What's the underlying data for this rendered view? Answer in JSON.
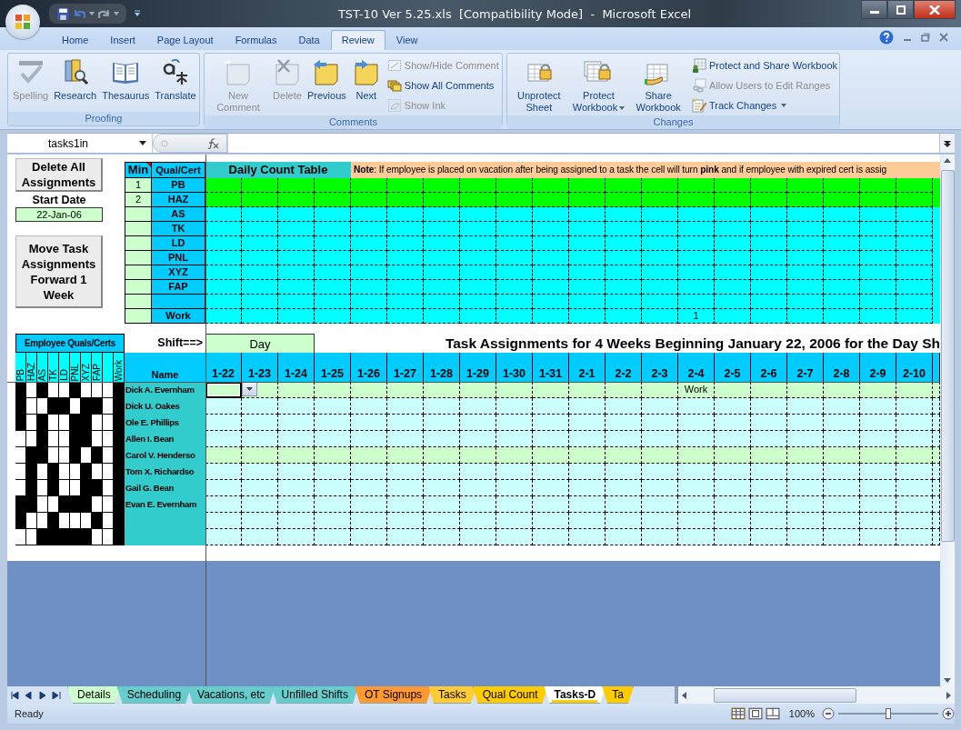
{
  "window": {
    "title": "TST-10 Ver 5.25.xls  [Compatibility Mode]  -  Microsoft Excel"
  },
  "ribbon_tabs": [
    {
      "label": "Home",
      "selected": false
    },
    {
      "label": "Insert",
      "selected": false
    },
    {
      "label": "Page Layout",
      "selected": false
    },
    {
      "label": "Formulas",
      "selected": false
    },
    {
      "label": "Data",
      "selected": false
    },
    {
      "label": "Review",
      "selected": true
    },
    {
      "label": "View",
      "selected": false
    }
  ],
  "ribbon_groups": [
    {
      "label": "Proofing",
      "commands": [
        {
          "label": "Spelling",
          "kind": "large",
          "disabled": true
        },
        {
          "label": "Research",
          "kind": "large",
          "disabled": false
        },
        {
          "label": "Thesaurus",
          "kind": "large",
          "disabled": false
        },
        {
          "label": "Translate",
          "kind": "large",
          "disabled": false
        }
      ]
    },
    {
      "label": "Comments",
      "commands": [
        {
          "label": "New Comment",
          "kind": "large",
          "disabled": true
        },
        {
          "label": "Delete",
          "kind": "large",
          "disabled": true
        },
        {
          "label": "Previous",
          "kind": "large",
          "disabled": false
        },
        {
          "label": "Next",
          "kind": "large",
          "disabled": false
        },
        {
          "label": "Show/Hide Comment",
          "kind": "small",
          "disabled": true
        },
        {
          "label": "Show All Comments",
          "kind": "small",
          "disabled": false
        },
        {
          "label": "Show Ink",
          "kind": "small",
          "disabled": true
        }
      ]
    },
    {
      "label": "Changes",
      "commands": [
        {
          "label": "Unprotect Sheet",
          "kind": "large",
          "disabled": false
        },
        {
          "label": "Protect Workbook",
          "kind": "large",
          "disabled": false,
          "dropdown": true
        },
        {
          "label": "Share Workbook",
          "kind": "large",
          "disabled": false
        },
        {
          "label": "Protect and Share Workbook",
          "kind": "small",
          "disabled": false
        },
        {
          "label": "Allow Users to Edit Ranges",
          "kind": "small",
          "disabled": true
        },
        {
          "label": "Track Changes",
          "kind": "small",
          "disabled": false,
          "dropdown": true
        }
      ]
    }
  ],
  "name_box": "tasks1in",
  "left_panel": {
    "delete_button": "Delete All Assignments",
    "start_date_label": "Start Date",
    "start_date": "22-Jan-06",
    "move_button": "Move Task Assignments Forward 1 Week"
  },
  "count_table": {
    "min_header": "Min",
    "qual_header": "Qual/Cert",
    "title": "Daily Count Table",
    "note": "**Note**: If employee is placed on vacation after being assigned to a task the cell will turn **pink** and if employee with expired cert is assig",
    "rows": [
      {
        "min": "1",
        "qual": "PB",
        "highlighted": true
      },
      {
        "min": "2",
        "qual": "HAZ",
        "highlighted": true
      },
      {
        "qual": "AS",
        "highlighted": false
      },
      {
        "qual": "TK",
        "highlighted": false
      },
      {
        "qual": "LD",
        "highlighted": false
      },
      {
        "qual": "PNL",
        "highlighted": false
      },
      {
        "qual": "XYZ",
        "highlighted": false
      },
      {
        "qual": "FAP",
        "highlighted": false
      },
      {
        "highlighted": false
      },
      {
        "qual": "Work",
        "highlighted": false,
        "cells": [
          {},
          {},
          {},
          {},
          {},
          {},
          {},
          {},
          {},
          {},
          {},
          {},
          {},
          {
            "text": "1"
          },
          {},
          {},
          {},
          {},
          {},
          {}
        ]
      }
    ]
  },
  "assignments": {
    "quals_header": "Employee Quals/Certs",
    "shift_label": "Shift==>",
    "shift": "Day",
    "title": "Task Assignments for 4 Weeks Beginning January 22, 2006 for the Day Sh",
    "name_header": "Name",
    "qual_columns": [
      {
        "label": "PB"
      },
      {
        "label": "HAZ"
      },
      {
        "label": "AS"
      },
      {
        "label": "TK"
      },
      {
        "label": "LD"
      },
      {
        "label": "PNL"
      },
      {
        "label": "XYZ"
      },
      {
        "label": "FAP"
      },
      {},
      {
        "label": "Work"
      }
    ],
    "dates": [
      "1-22",
      "1-23",
      "1-24",
      "1-25",
      "1-26",
      "1-27",
      "1-28",
      "1-29",
      "1-30",
      "1-31",
      "2-1",
      "2-2",
      "2-3",
      "2-4",
      "2-5",
      "2-6",
      "2-7",
      "2-8",
      "2-9",
      "2-10"
    ],
    "employees": [
      {
        "name": "Dick A. Evernham",
        "highlighted": true,
        "certs": [
          true,
          false,
          true,
          false,
          false,
          true,
          false,
          false,
          false,
          true
        ],
        "cells": [
          {
            "selected": true
          },
          {
            "selected": false
          },
          {
            "selected": false
          },
          {
            "selected": false
          },
          {
            "selected": false
          },
          {
            "selected": false
          },
          {
            "selected": false
          },
          {
            "selected": false
          },
          {
            "selected": false
          },
          {
            "selected": false
          },
          {
            "selected": false
          },
          {
            "selected": false
          },
          {
            "selected": false
          },
          {
            "selected": false,
            "text": "Work"
          },
          {
            "selected": false
          },
          {
            "selected": false
          },
          {
            "selected": false
          },
          {
            "selected": false
          },
          {
            "selected": false
          },
          {
            "selected": false
          }
        ]
      },
      {
        "name": "Dick U. Oakes",
        "highlighted": false,
        "certs": [
          true,
          false,
          false,
          true,
          true,
          false,
          true,
          true,
          false,
          true
        ]
      },
      {
        "name": "Ole E. Phillips",
        "highlighted": false,
        "certs": [
          true,
          false,
          true,
          false,
          false,
          true,
          true,
          false,
          false,
          true
        ]
      },
      {
        "name": "Allen I. Bean",
        "highlighted": false,
        "certs": [
          false,
          false,
          true,
          false,
          false,
          true,
          true,
          false,
          false,
          true
        ]
      },
      {
        "name": "Carol V. Henderso",
        "highlighted": true,
        "certs": [
          false,
          true,
          true,
          false,
          false,
          true,
          false,
          true,
          false,
          true
        ]
      },
      {
        "name": "Tom X. Richardso",
        "highlighted": false,
        "certs": [
          false,
          true,
          false,
          true,
          false,
          false,
          true,
          false,
          false,
          true
        ]
      },
      {
        "name": "Gail G. Bean",
        "highlighted": false,
        "certs": [
          false,
          true,
          false,
          true,
          false,
          false,
          true,
          true,
          false,
          true
        ]
      },
      {
        "name": "Evan E. Evernham",
        "highlighted": false,
        "certs": [
          true,
          true,
          false,
          false,
          true,
          true,
          true,
          false,
          false,
          true
        ]
      },
      {
        "highlighted": false,
        "certs": [
          true,
          false,
          false,
          true,
          false,
          false,
          false,
          true,
          false,
          true
        ]
      },
      {
        "highlighted": false,
        "certs": [
          false,
          false,
          true,
          true,
          true,
          true,
          true,
          false,
          false,
          true
        ]
      }
    ]
  },
  "sheet_tabs": [
    {
      "label": "Details",
      "selected": false,
      "color": "#ccffcc"
    },
    {
      "label": "Scheduling",
      "selected": false,
      "color": "#66cccc"
    },
    {
      "label": "Vacations, etc",
      "selected": false,
      "color": "#66cccc"
    },
    {
      "label": "Unfilled Shifts",
      "selected": false,
      "color": "#66cccc"
    },
    {
      "label": "OT Signups",
      "selected": false,
      "color": "#ff9933"
    },
    {
      "label": "Tasks",
      "selected": false,
      "color": "#ffcc33"
    },
    {
      "label": "Qual Count",
      "selected": false,
      "color": "#ffcc00"
    },
    {
      "label": "Tasks-D",
      "selected": true,
      "color": "#ffcc00"
    },
    {
      "label": "Ta",
      "selected": false,
      "color": "#ffcc00"
    }
  ],
  "status_bar": {
    "status": "Ready",
    "zoom": "100%",
    "zoom_slider": {
      "level": 0.5
    }
  }
}
